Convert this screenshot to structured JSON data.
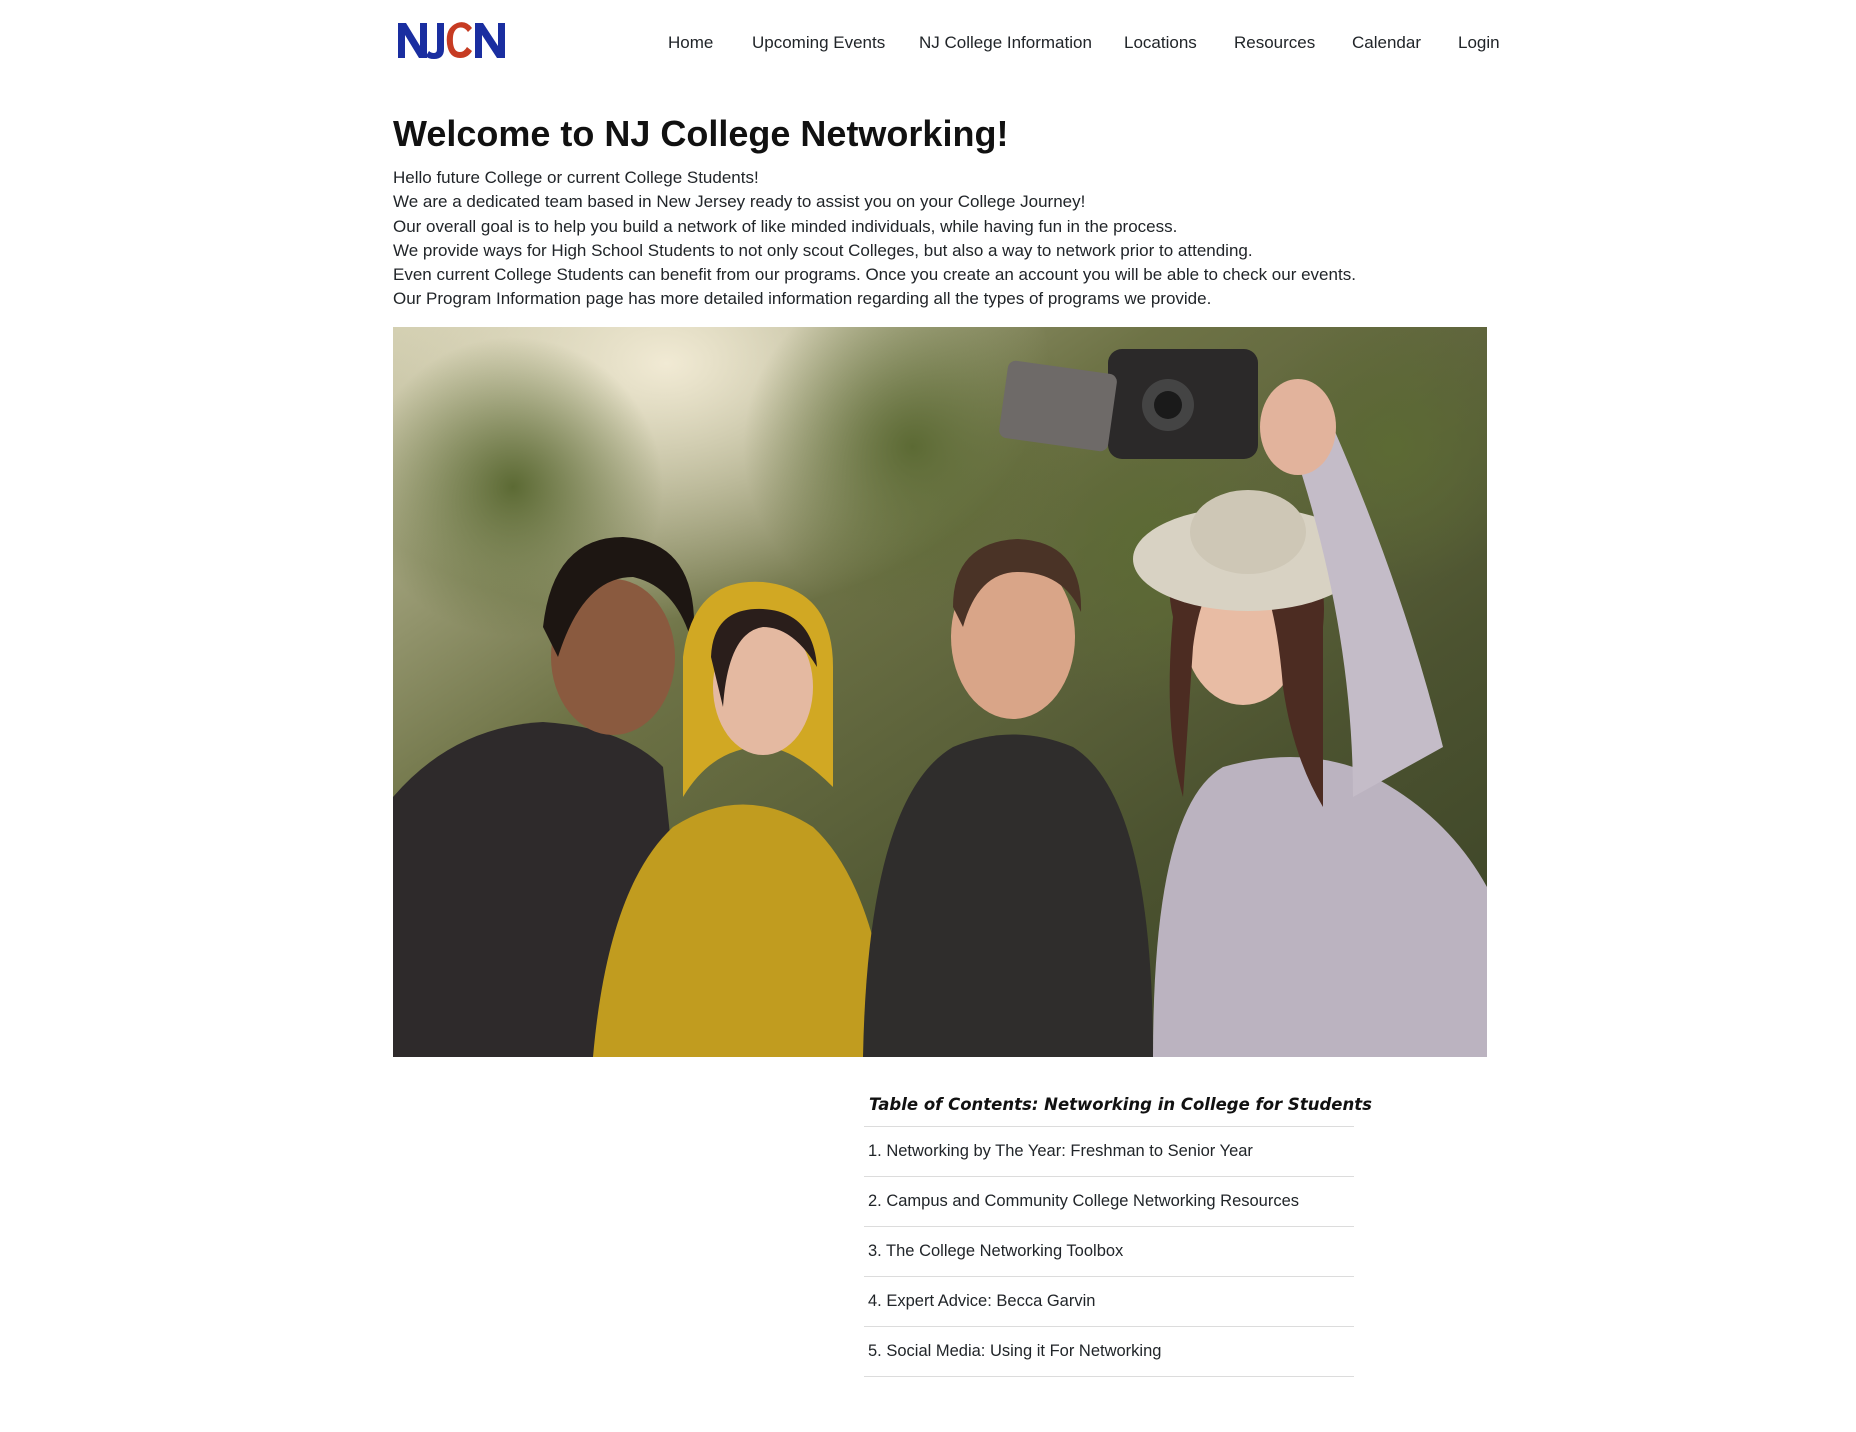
{
  "brand": {
    "logo_text": "NJCN",
    "colors": {
      "blue": "#1a2ea0",
      "red": "#c63b22"
    }
  },
  "nav": {
    "items": [
      {
        "label": "Home"
      },
      {
        "label": "Upcoming Events"
      },
      {
        "label": "NJ College Information"
      },
      {
        "label": "Locations"
      },
      {
        "label": "Resources"
      },
      {
        "label": "Calendar"
      },
      {
        "label": "Login"
      }
    ]
  },
  "main": {
    "title": "Welcome to NJ College Networking!",
    "intro_lines": [
      "Hello future College or current College Students!",
      "We are a dedicated team based in New Jersey ready to assist you on your College Journey!",
      "Our overall goal is to help you build a network of like minded individuals, while having fun in the process.",
      "We provide ways for High School Students to not only scout Colleges, but also a way to network prior to attending.",
      "Even current College Students can benefit from our programs. Once you create an account you will be able to check our events.",
      "Our Program Information page has more detailed information regarding all the types of programs we provide."
    ]
  },
  "toc": {
    "title": "Table of Contents: Networking in College for Students",
    "items": [
      {
        "label": "1. Networking by The Year: Freshman to Senior Year"
      },
      {
        "label": "2. Campus and Community College Networking Resources"
      },
      {
        "label": "3. The College Networking Toolbox"
      },
      {
        "label": "4. Expert Advice: Becca Garvin"
      },
      {
        "label": "5. Social Media: Using it For Networking"
      }
    ]
  }
}
